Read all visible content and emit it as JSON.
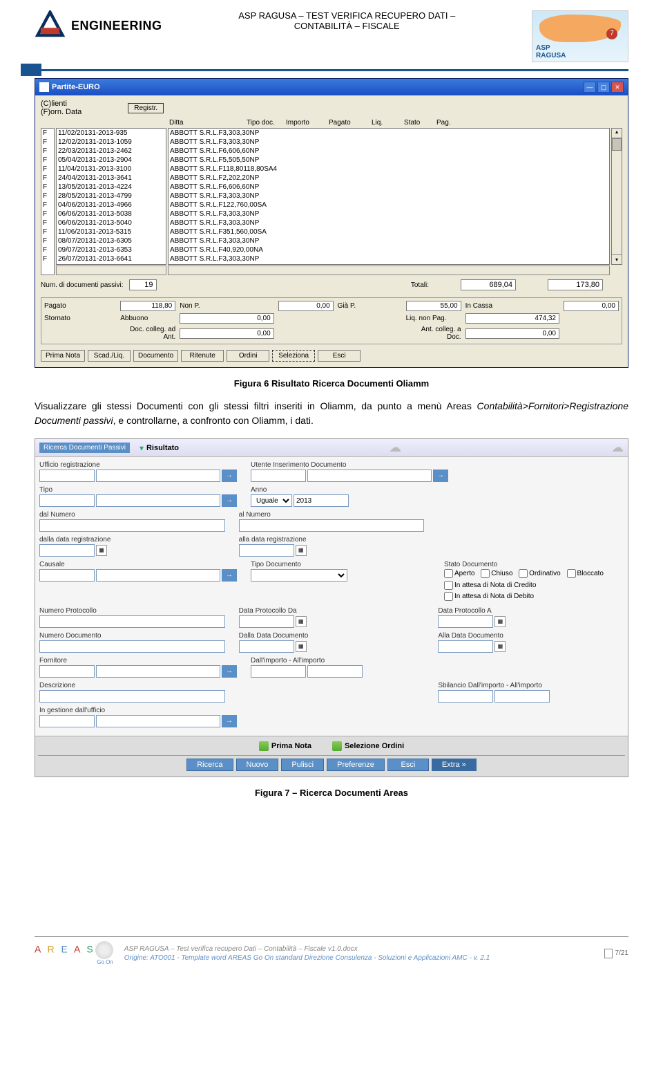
{
  "header": {
    "brand": "ENGINEERING",
    "title_l1": "ASP RAGUSA – TEST VERIFICA RECUPERO DATI –",
    "title_l2": "CONTABILITÀ – FISCALE",
    "badge_org": "ASP",
    "badge_place": "RAGUSA",
    "badge_num": "7"
  },
  "win": {
    "title": "Partite-EURO",
    "top_label1": "(C)lienti",
    "top_label2": "(F)orn. Data",
    "btn_registr": "Registr.",
    "cols": [
      "Ditta",
      "Tipo doc.",
      "Importo",
      "Pagato",
      "Liq.",
      "Stato",
      "Pag."
    ],
    "rows": [
      {
        "f": "F",
        "d": "11/02/2013",
        "num": "1-2013-935",
        "ditta": "ABBOTT S.R.L.",
        "td": "F",
        "imp": "3,30",
        "pag": "3,30",
        "liq": "N",
        "st": "P",
        "pg": ""
      },
      {
        "f": "F",
        "d": "12/02/2013",
        "num": "1-2013-1059",
        "ditta": "ABBOTT S.R.L.",
        "td": "F",
        "imp": "3,30",
        "pag": "3,30",
        "liq": "N",
        "st": "P",
        "pg": ""
      },
      {
        "f": "F",
        "d": "22/03/2013",
        "num": "1-2013-2462",
        "ditta": "ABBOTT S.R.L.",
        "td": "F",
        "imp": "6,60",
        "pag": "6,60",
        "liq": "N",
        "st": "P",
        "pg": ""
      },
      {
        "f": "F",
        "d": "05/04/2013",
        "num": "1-2013-2904",
        "ditta": "ABBOTT S.R.L.",
        "td": "F",
        "imp": "5,50",
        "pag": "5,50",
        "liq": "N",
        "st": "P",
        "pg": ""
      },
      {
        "f": "F",
        "d": "11/04/2013",
        "num": "1-2013-3100",
        "ditta": "ABBOTT S.R.L.",
        "td": "F",
        "imp": "118,80",
        "pag": "118,80",
        "liq": "S",
        "st": "A",
        "pg": "4"
      },
      {
        "f": "F",
        "d": "24/04/2013",
        "num": "1-2013-3641",
        "ditta": "ABBOTT S.R.L.",
        "td": "F",
        "imp": "2,20",
        "pag": "2,20",
        "liq": "N",
        "st": "P",
        "pg": ""
      },
      {
        "f": "F",
        "d": "13/05/2013",
        "num": "1-2013-4224",
        "ditta": "ABBOTT S.R.L.",
        "td": "F",
        "imp": "6,60",
        "pag": "6,60",
        "liq": "N",
        "st": "P",
        "pg": ""
      },
      {
        "f": "F",
        "d": "28/05/2013",
        "num": "1-2013-4799",
        "ditta": "ABBOTT S.R.L.",
        "td": "F",
        "imp": "3,30",
        "pag": "3,30",
        "liq": "N",
        "st": "P",
        "pg": ""
      },
      {
        "f": "F",
        "d": "04/06/2013",
        "num": "1-2013-4966",
        "ditta": "ABBOTT S.R.L.",
        "td": "F",
        "imp": "122,76",
        "pag": "0,00",
        "liq": "S",
        "st": "A",
        "pg": ""
      },
      {
        "f": "F",
        "d": "06/06/2013",
        "num": "1-2013-5038",
        "ditta": "ABBOTT S.R.L.",
        "td": "F",
        "imp": "3,30",
        "pag": "3,30",
        "liq": "N",
        "st": "P",
        "pg": ""
      },
      {
        "f": "F",
        "d": "06/06/2013",
        "num": "1-2013-5040",
        "ditta": "ABBOTT S.R.L.",
        "td": "F",
        "imp": "3,30",
        "pag": "3,30",
        "liq": "N",
        "st": "P",
        "pg": ""
      },
      {
        "f": "F",
        "d": "11/06/2013",
        "num": "1-2013-5315",
        "ditta": "ABBOTT S.R.L.",
        "td": "F",
        "imp": "351,56",
        "pag": "0,00",
        "liq": "S",
        "st": "A",
        "pg": ""
      },
      {
        "f": "F",
        "d": "08/07/2013",
        "num": "1-2013-6305",
        "ditta": "ABBOTT S.R.L.",
        "td": "F",
        "imp": "3,30",
        "pag": "3,30",
        "liq": "N",
        "st": "P",
        "pg": ""
      },
      {
        "f": "F",
        "d": "09/07/2013",
        "num": "1-2013-6353",
        "ditta": "ABBOTT S.R.L.",
        "td": "F",
        "imp": "40,92",
        "pag": "0,00",
        "liq": "N",
        "st": "A",
        "pg": ""
      },
      {
        "f": "F",
        "d": "26/07/2013",
        "num": "1-2013-6641",
        "ditta": "ABBOTT S.R.L.",
        "td": "F",
        "imp": "3,30",
        "pag": "3,30",
        "liq": "N",
        "st": "P",
        "pg": ""
      }
    ],
    "totals": {
      "num_docs_label": "Num. di documenti passivi:",
      "num_docs": "19",
      "totali_label": "Totali:",
      "tot_imp": "689,04",
      "tot_pag": "173,80"
    },
    "summary": {
      "pagato_l": "Pagato",
      "pagato": "118,80",
      "nonp_l": "Non P.",
      "nonp": "0,00",
      "giap_l": "Già P.",
      "giap": "55,00",
      "incassa_l": "In Cassa",
      "incassa": "0,00",
      "stornato_l": "Stornato",
      "stornato": "0,00",
      "abbuono_l": "Abbuono",
      "abbuono": "0,00",
      "liqnp_l": "Liq. non Pag.",
      "liqnp": "474,32",
      "dca_l": "Doc. colleg. ad Ant.",
      "dca": "0,00",
      "acd_l": "Ant. colleg. a Doc.",
      "acd": "0,00"
    },
    "buttons": [
      "Prima Nota",
      "Scad./Liq.",
      "Documento",
      "Ritenute",
      "Ordini",
      "Seleziona",
      "Esci"
    ]
  },
  "fig6": "Figura 6 Risultato Ricerca Documenti Oliamm",
  "para": {
    "pre": "Visualizzare gli stessi Documenti con gli stessi filtri inseriti in Oliamm, da punto a menù Areas ",
    "em": "Contabilità>Fornitori>Registrazione Documenti passivi",
    "post": ", e controllarne, a confronto con Oliamm, i dati."
  },
  "wf": {
    "crumb": "Ricerca Documenti Passivi",
    "risultato": "Risultato",
    "labels": {
      "ufficio": "Ufficio registrazione",
      "utente": "Utente Inserimento Documento",
      "tipo": "Tipo",
      "anno": "Anno",
      "anno_op": "Uguale",
      "anno_val": "2013",
      "dalnum": "dal Numero",
      "alnum": "al Numero",
      "dallareg": "dalla data registrazione",
      "allareg": "alla data registrazione",
      "causale": "Causale",
      "tipodoc": "Tipo Documento",
      "statodoc": "Stato Documento",
      "aperto": "Aperto",
      "chiuso": "Chiuso",
      "ordinativo": "Ordinativo",
      "bloccato": "Bloccato",
      "attesacred": "In attesa di Nota di Credito",
      "attesadeb": "In attesa di Nota di Debito",
      "numproto": "Numero Protocollo",
      "dataprotoda": "Data Protocollo Da",
      "dataprotoa": "Data Protocollo A",
      "numdoc": "Numero Documento",
      "dalladoc": "Dalla Data Documento",
      "alladoc": "Alla Data Documento",
      "fornitore": "Fornitore",
      "dallimporto": "Dall'importo - All'importo",
      "descrizione": "Descrizione",
      "sbilancio": "Sbilancio Dall'importo - All'importo",
      "gestione": "In gestione dall'ufficio"
    },
    "links": {
      "prima": "Prima Nota",
      "selord": "Selezione Ordini"
    },
    "btns": {
      "ricerca": "Ricerca",
      "nuovo": "Nuovo",
      "pulisci": "Pulisci",
      "pref": "Preferenze",
      "esci": "Esci",
      "extra": "Extra  »"
    }
  },
  "fig7": "Figura 7 – Ricerca Documenti Areas",
  "footer": {
    "l1": "ASP RAGUSA – Test verifica recupero Dati – Contabilità – Fiscale v1.0.docx",
    "l2": "Origine: ATO001 - Template word AREAS Go On standard Direzione Consulenza - Soluzioni e Applicazioni AMC - v. 2.1",
    "page": "7/21",
    "goon": "Go On"
  }
}
